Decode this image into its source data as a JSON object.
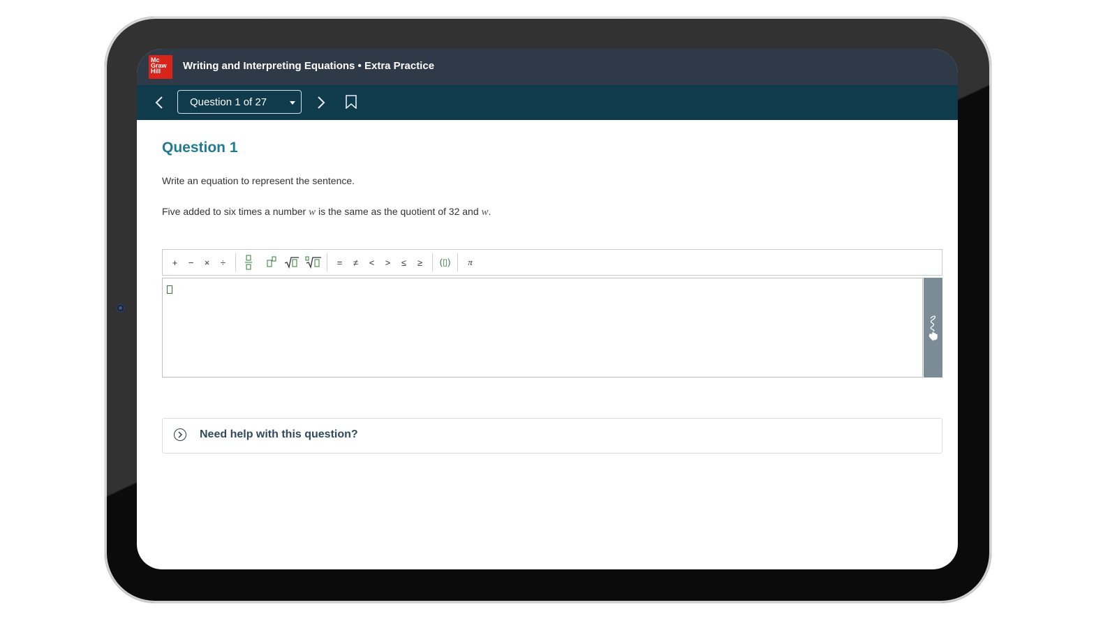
{
  "header": {
    "logo_lines": [
      "Mc",
      "Graw",
      "Hill"
    ],
    "title": "Writing and Interpreting Equations • Extra Practice"
  },
  "nav": {
    "question_select": "Question 1 of 27"
  },
  "question": {
    "heading": "Question 1",
    "prompt": "Write an equation to represent the sentence.",
    "sentence_parts": [
      "Five added to six times a number ",
      "w",
      " is the same as the quotient of 32 and ",
      "w",
      "."
    ]
  },
  "toolbar": {
    "group1": [
      "+",
      "−",
      "×",
      "÷"
    ],
    "group2": [
      "▯/▯",
      "▯▯",
      "√▯",
      "∛▯"
    ],
    "group3": [
      "=",
      "≠",
      "<",
      ">",
      "≤",
      "≥"
    ],
    "group4": [
      "(▯)"
    ],
    "group5": [
      "π"
    ]
  },
  "help": {
    "label": "Need help with this question?"
  }
}
